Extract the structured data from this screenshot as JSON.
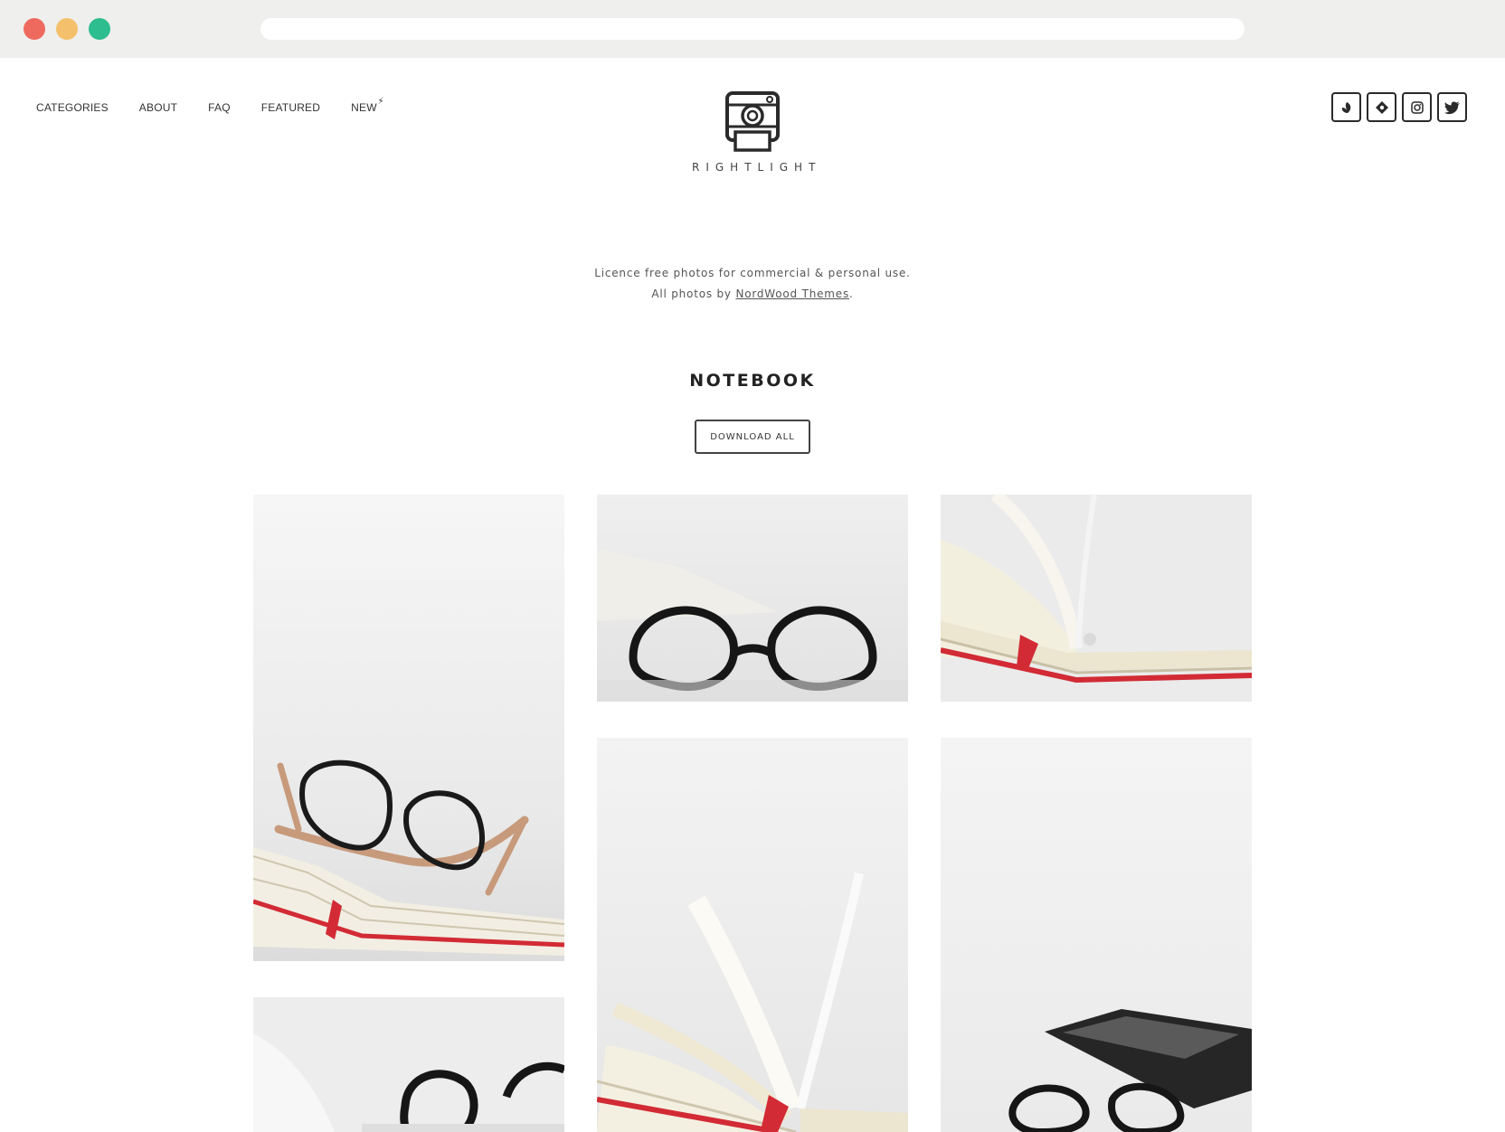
{
  "colors": {
    "close_dot": "#ee6a5f",
    "minimize_dot": "#f5c06b",
    "zoom_dot": "#2dbd8e",
    "accent_red": "#d22b35"
  },
  "nav": {
    "items": [
      {
        "label": "CATEGORIES"
      },
      {
        "label": "ABOUT"
      },
      {
        "label": "FAQ"
      },
      {
        "label": "FEATURED"
      },
      {
        "label": "NEW",
        "badge": "⚡"
      }
    ]
  },
  "logo": {
    "text": "RIGHTLIGHT",
    "icon": "instant-camera-icon"
  },
  "social": [
    {
      "icon": "dribbble-icon"
    },
    {
      "icon": "tag-icon"
    },
    {
      "icon": "instagram-icon"
    },
    {
      "icon": "twitter-icon"
    }
  ],
  "intro": {
    "line1": "Licence free photos for commercial & personal use.",
    "line2_prefix": "All photos by ",
    "link": "NordWood Themes",
    "line2_suffix": "."
  },
  "collection": {
    "title": "NOTEBOOK",
    "download_label": "DOWNLOAD ALL"
  },
  "gallery": [
    {
      "subject": "wooden glasses on open notebook"
    },
    {
      "subject": "black glasses in front of notebook"
    },
    {
      "subject": "open notebook with red bookmark"
    },
    {
      "subject": "notebook pages fanning"
    },
    {
      "subject": "glasses beside e-reader"
    },
    {
      "subject": "black glasses on notebook"
    }
  ]
}
